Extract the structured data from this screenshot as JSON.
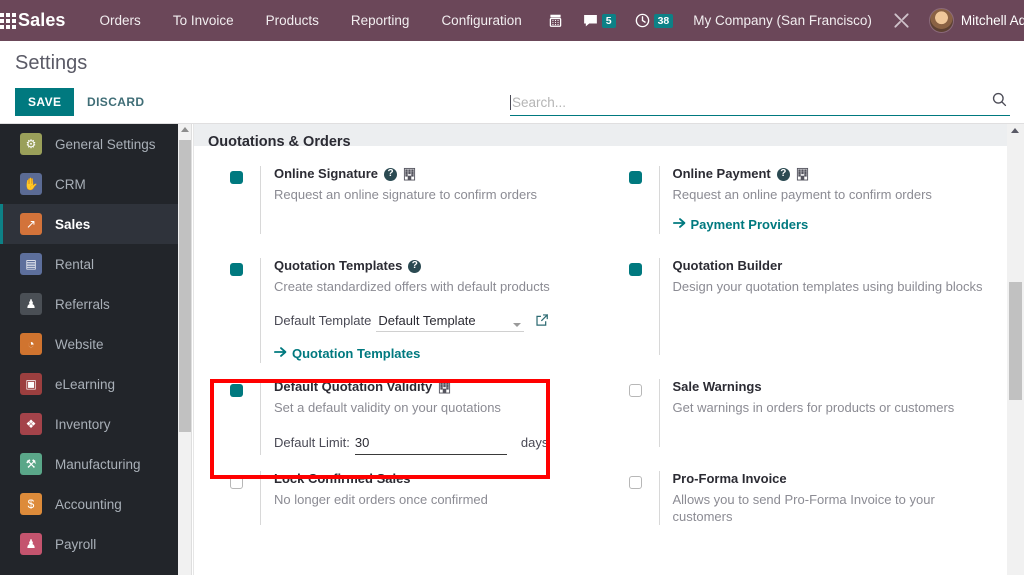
{
  "topnav": {
    "apps_icon": "apps-grid-icon",
    "brand": "Sales",
    "menus": [
      "Orders",
      "To Invoice",
      "Products",
      "Reporting",
      "Configuration"
    ],
    "sys": [
      {
        "icon": "voip-phone-icon",
        "badge": ""
      },
      {
        "icon": "messages-icon",
        "badge": "5"
      },
      {
        "icon": "activities-clock-icon",
        "badge": "38"
      }
    ],
    "company": "My Company (San Francisco)",
    "debug_icon": "tools-wrench-icon",
    "user": "Mitchell Admin"
  },
  "control": {
    "title": "Settings",
    "save_label": "SAVE",
    "discard_label": "DISCARD",
    "search_placeholder": "Search...",
    "search_value": "",
    "search_icon": "search-icon"
  },
  "sidebar": {
    "items": [
      {
        "label": "General Settings",
        "icon": "gear-icon",
        "color": "#9aa05a",
        "glyph": "⚙",
        "active": false
      },
      {
        "label": "CRM",
        "icon": "handshake-icon",
        "color": "#5b6b94",
        "glyph": "✋",
        "active": false
      },
      {
        "label": "Sales",
        "icon": "chart-line-icon",
        "color": "#d3733a",
        "glyph": "↗",
        "active": true
      },
      {
        "label": "Rental",
        "icon": "calendar-icon",
        "color": "#5d6f9c",
        "glyph": "▤",
        "active": false
      },
      {
        "label": "Referrals",
        "icon": "gift-icon",
        "color": "#4a4f55",
        "glyph": "♟",
        "active": false
      },
      {
        "label": "Website",
        "icon": "globe-icon",
        "color": "#d0742f",
        "glyph": "◔",
        "active": false
      },
      {
        "label": "eLearning",
        "icon": "presentation-icon",
        "color": "#9c3f3f",
        "glyph": "▣",
        "active": false
      },
      {
        "label": "Inventory",
        "icon": "box-icon",
        "color": "#a4434a",
        "glyph": "❖",
        "active": false
      },
      {
        "label": "Manufacturing",
        "icon": "wrench-icon",
        "color": "#5aa789",
        "glyph": "⚒",
        "active": false
      },
      {
        "label": "Accounting",
        "icon": "invoice-dollar-icon",
        "color": "#dd8b3a",
        "glyph": "$",
        "active": false
      },
      {
        "label": "Payroll",
        "icon": "user-badge-icon",
        "color": "#c4546e",
        "glyph": "♟",
        "active": false
      }
    ]
  },
  "main": {
    "section_title": "Quotations & Orders",
    "options": [
      {
        "id": "online-signature",
        "title": "Online Signature",
        "desc": "Request an online signature to confirm orders",
        "checked": true,
        "has_help": true,
        "has_company": true,
        "link": "",
        "column": "left"
      },
      {
        "id": "online-payment",
        "title": "Online Payment",
        "desc": "Request an online payment to confirm orders",
        "checked": true,
        "has_help": true,
        "has_company": true,
        "link": "Payment Providers",
        "column": "right"
      },
      {
        "id": "quotation-templates",
        "title": "Quotation Templates",
        "desc": "Create standardized offers with default products",
        "checked": true,
        "has_help": true,
        "has_company": false,
        "field_label": "Default Template",
        "field_value": "Default Template",
        "link": "Quotation Templates",
        "column": "left"
      },
      {
        "id": "quotation-builder",
        "title": "Quotation Builder",
        "desc": "Design your quotation templates using building blocks",
        "checked": true,
        "has_help": false,
        "has_company": false,
        "link": "",
        "column": "right"
      },
      {
        "id": "default-quotation-validity",
        "title": "Default Quotation Validity",
        "desc": "Set a default validity on your quotations",
        "checked": true,
        "has_help": false,
        "has_company": true,
        "field_label": "Default Limit:",
        "field_value": "30",
        "field_unit": "days",
        "link": "",
        "column": "left",
        "highlighted": true
      },
      {
        "id": "sale-warnings",
        "title": "Sale Warnings",
        "desc": "Get warnings in orders for products or customers",
        "checked": false,
        "has_help": false,
        "has_company": false,
        "link": "",
        "column": "right"
      },
      {
        "id": "lock-confirmed-sales",
        "title": "Lock Confirmed Sales",
        "desc": "No longer edit orders once confirmed",
        "checked": false,
        "has_help": false,
        "has_company": false,
        "link": "",
        "column": "left"
      },
      {
        "id": "pro-forma-invoice",
        "title": "Pro-Forma Invoice",
        "desc": "Allows you to send Pro-Forma Invoice to your customers",
        "checked": false,
        "has_help": false,
        "has_company": false,
        "link": "",
        "column": "right"
      }
    ]
  },
  "colors": {
    "brand_purple": "#6b4759",
    "accent_teal": "#00797f",
    "badge_teal": "#0d8186",
    "sidebar_dark": "#22252a",
    "highlight_red": "#ff0000"
  }
}
